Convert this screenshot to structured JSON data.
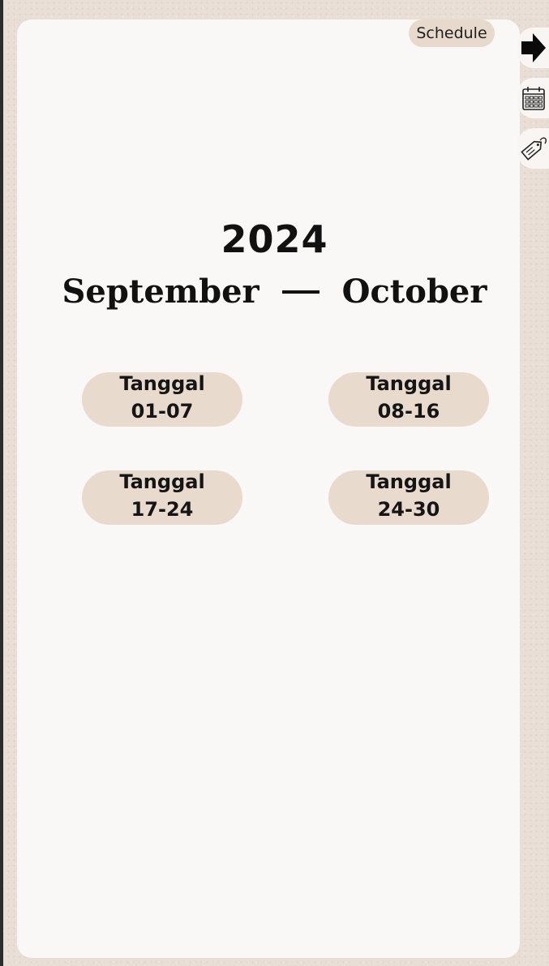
{
  "header": {
    "schedule_label": "Schedule"
  },
  "side_tabs": [
    {
      "icon": "arrow-right-icon"
    },
    {
      "icon": "calendar-icon"
    },
    {
      "icon": "price-tag-icon"
    }
  ],
  "title": {
    "year": "2024",
    "month_start": "September",
    "month_end": "October"
  },
  "date_ranges": [
    {
      "label": "Tanggal",
      "range": "01-07"
    },
    {
      "label": "Tanggal",
      "range": "08-16"
    },
    {
      "label": "Tanggal",
      "range": "17-24"
    },
    {
      "label": "Tanggal",
      "range": "24-30"
    }
  ],
  "colors": {
    "background": "#e8ded5",
    "page": "#faf8f6",
    "pill": "#e8dbce",
    "text": "#111111"
  }
}
